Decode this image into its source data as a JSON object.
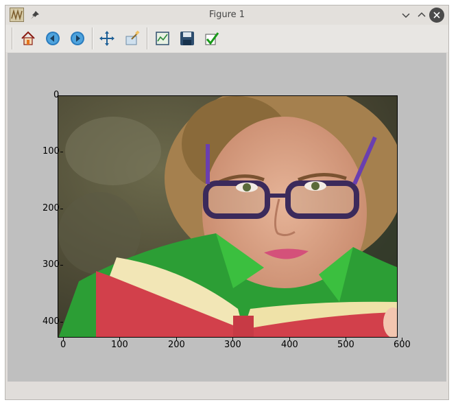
{
  "window": {
    "title": "Figure 1"
  },
  "toolbar": {
    "tools": [
      {
        "name": "home",
        "icon": "home-icon"
      },
      {
        "name": "back",
        "icon": "back-arrow-icon"
      },
      {
        "name": "forward",
        "icon": "forward-arrow-icon"
      },
      {
        "name": "pan",
        "icon": "move-icon"
      },
      {
        "name": "zoom",
        "icon": "zoom-rect-icon"
      },
      {
        "name": "subplots",
        "icon": "subplots-icon"
      },
      {
        "name": "save",
        "icon": "save-icon"
      },
      {
        "name": "edit",
        "icon": "checkmark-icon"
      }
    ]
  },
  "plot": {
    "x_ticks": [
      "0",
      "100",
      "200",
      "300",
      "400",
      "500",
      "600"
    ],
    "y_ticks": [
      "0",
      "100",
      "200",
      "300",
      "400"
    ],
    "xlim": [
      0,
      600
    ],
    "ylim": [
      0,
      427
    ]
  },
  "colors": {
    "canvas_bg": "#bfbfbf",
    "window_bg": "#e0ddda",
    "accent_blue": "#2a7bbd"
  }
}
